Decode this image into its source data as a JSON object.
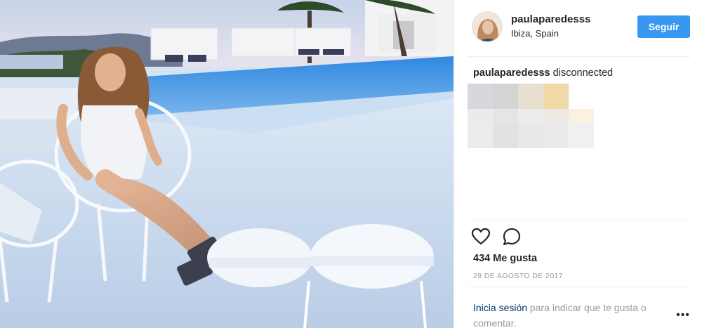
{
  "post": {
    "image_alt": "Woman sitting in a white chair by an infinity pool at sunset"
  },
  "header": {
    "username": "paulaparedesss",
    "location": "Ibiza, Spain",
    "follow_label": "Seguir"
  },
  "caption": {
    "username": "paulaparedesss",
    "text": "disconnected"
  },
  "actions": {
    "like_icon": "heart-icon",
    "comment_icon": "comment-icon"
  },
  "stats": {
    "likes": "434 Me gusta",
    "date": "29 DE AGOSTO DE 2017"
  },
  "footer": {
    "login_link": "Inicia sesión",
    "login_text": " para indicar que te gusta o comentar.",
    "more_label": "•••"
  },
  "colors": {
    "accent": "#3897f0",
    "link": "#003569",
    "muted": "#999999"
  }
}
